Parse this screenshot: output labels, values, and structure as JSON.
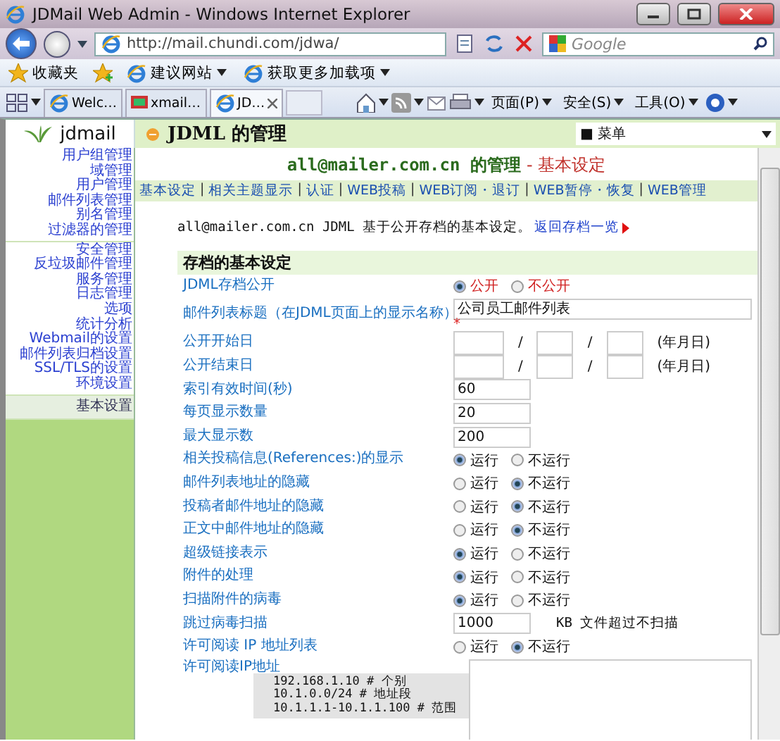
{
  "window": {
    "title": "JDMail Web Admin - Windows Internet Explorer"
  },
  "address_bar": {
    "url": "http://mail.chundi.com/jdwa/"
  },
  "search": {
    "placeholder": "Google"
  },
  "favorites_bar": [
    {
      "kind": "favorites",
      "label": "收藏夹",
      "menu": false
    },
    {
      "kind": "site",
      "label": "建议网站",
      "menu": true
    },
    {
      "kind": "site",
      "label": "获取更多加载项",
      "menu": true
    }
  ],
  "tabs": [
    {
      "label": "Welc…",
      "selected": false
    },
    {
      "label": "xmail…",
      "selected": false
    },
    {
      "label": "JD…",
      "selected": true
    }
  ],
  "command_bar": [
    {
      "label": "页面(P)"
    },
    {
      "label": "安全(S)"
    },
    {
      "label": "工具(O)"
    }
  ],
  "app": {
    "logo": "jdmail",
    "title": "JDML 的管理",
    "menu_select": "■ 菜单"
  },
  "sidebar": {
    "groups": [
      [
        {
          "label": "用户组管理",
          "selected": false
        },
        {
          "label": "域管理",
          "selected": false
        },
        {
          "label": "用户管理",
          "selected": false
        },
        {
          "label": "邮件列表管理",
          "selected": false
        },
        {
          "label": "别名管理",
          "selected": false
        },
        {
          "label": "过滤器的管理",
          "selected": false
        }
      ],
      [
        {
          "label": "安全管理",
          "selected": false
        },
        {
          "label": "反垃圾邮件管理",
          "selected": false
        },
        {
          "label": "服务管理",
          "selected": false
        },
        {
          "label": "日志管理",
          "selected": false
        },
        {
          "label": "选项",
          "selected": false
        },
        {
          "label": "统计分析",
          "selected": false
        },
        {
          "label": "Webmail的设置",
          "selected": false
        },
        {
          "label": "邮件列表归档设置",
          "selected": false
        },
        {
          "label": "SSL/TLS的设置",
          "selected": false
        },
        {
          "label": "环境设置",
          "selected": false
        }
      ],
      [
        {
          "label": "基本设置",
          "selected": true
        }
      ]
    ]
  },
  "page": {
    "heading": "all@mailer.com.cn 的管理",
    "subheading": "- 基本设定",
    "nav_links": [
      "基本设定",
      "相关主题显示",
      "认证",
      "WEB投稿",
      "WEB订阅・退订",
      "WEB暂停・恢复",
      "WEB管理"
    ],
    "nav_separator": "|",
    "intro": "all@mailer.com.cn JDML 基于公开存档的基本设定。",
    "back_link": "返回存档一览"
  },
  "section": {
    "title": "存档的基本设定",
    "rows": [
      {
        "kind": "radio",
        "label": "JDML存档公开",
        "highlight": true,
        "options": [
          {
            "label": "公开",
            "selected": true
          },
          {
            "label": "不公开",
            "selected": false
          }
        ]
      },
      {
        "kind": "text",
        "label": "邮件列表标题（在JDML页面上的显示名称）",
        "value": "公司员工邮件列表",
        "required": "*"
      },
      {
        "kind": "date",
        "label": "公开开始日",
        "separator": "/",
        "suffix": "(年月日)"
      },
      {
        "kind": "date",
        "label": "公开结束日",
        "separator": "/",
        "suffix": "(年月日)"
      },
      {
        "kind": "text",
        "label": "索引有效时间(秒)",
        "value": "60"
      },
      {
        "kind": "text",
        "label": "每页显示数量",
        "value": "20"
      },
      {
        "kind": "text",
        "label": "最大显示数",
        "value": "200"
      },
      {
        "kind": "radio",
        "label": "相关投稿信息(References:)的显示",
        "highlight": false,
        "options": [
          {
            "label": "运行",
            "selected": true
          },
          {
            "label": "不运行",
            "selected": false
          }
        ]
      },
      {
        "kind": "radio",
        "label": "邮件列表地址的隐藏",
        "highlight": false,
        "options": [
          {
            "label": "运行",
            "selected": false
          },
          {
            "label": "不运行",
            "selected": true
          }
        ]
      },
      {
        "kind": "radio",
        "label": "投稿者邮件地址的隐藏",
        "highlight": false,
        "options": [
          {
            "label": "运行",
            "selected": false
          },
          {
            "label": "不运行",
            "selected": true
          }
        ]
      },
      {
        "kind": "radio",
        "label": "正文中邮件地址的隐藏",
        "highlight": false,
        "options": [
          {
            "label": "运行",
            "selected": false
          },
          {
            "label": "不运行",
            "selected": true
          }
        ]
      },
      {
        "kind": "radio",
        "label": "超级链接表示",
        "highlight": false,
        "options": [
          {
            "label": "运行",
            "selected": true
          },
          {
            "label": "不运行",
            "selected": false
          }
        ]
      },
      {
        "kind": "radio",
        "label": "附件的处理",
        "highlight": false,
        "options": [
          {
            "label": "运行",
            "selected": true
          },
          {
            "label": "不运行",
            "selected": false
          }
        ]
      },
      {
        "kind": "radio",
        "label": "扫描附件的病毒",
        "highlight": false,
        "options": [
          {
            "label": "运行",
            "selected": true
          },
          {
            "label": "不运行",
            "selected": false
          }
        ]
      },
      {
        "kind": "text",
        "label": "跳过病毒扫描",
        "value": "1000",
        "note": "KB 文件超过不扫描"
      },
      {
        "kind": "radio",
        "label": "许可阅读 IP 地址列表",
        "highlight": false,
        "options": [
          {
            "label": "运行",
            "selected": false
          },
          {
            "label": "不运行",
            "selected": true
          }
        ]
      },
      {
        "kind": "textarea",
        "label": "许可阅读IP地址",
        "hint_lines": [
          "192.168.1.10 # 个别",
          "10.1.0.0/24 # 地址段",
          "10.1.1.1-10.1.1.100 # 范围"
        ]
      }
    ]
  }
}
